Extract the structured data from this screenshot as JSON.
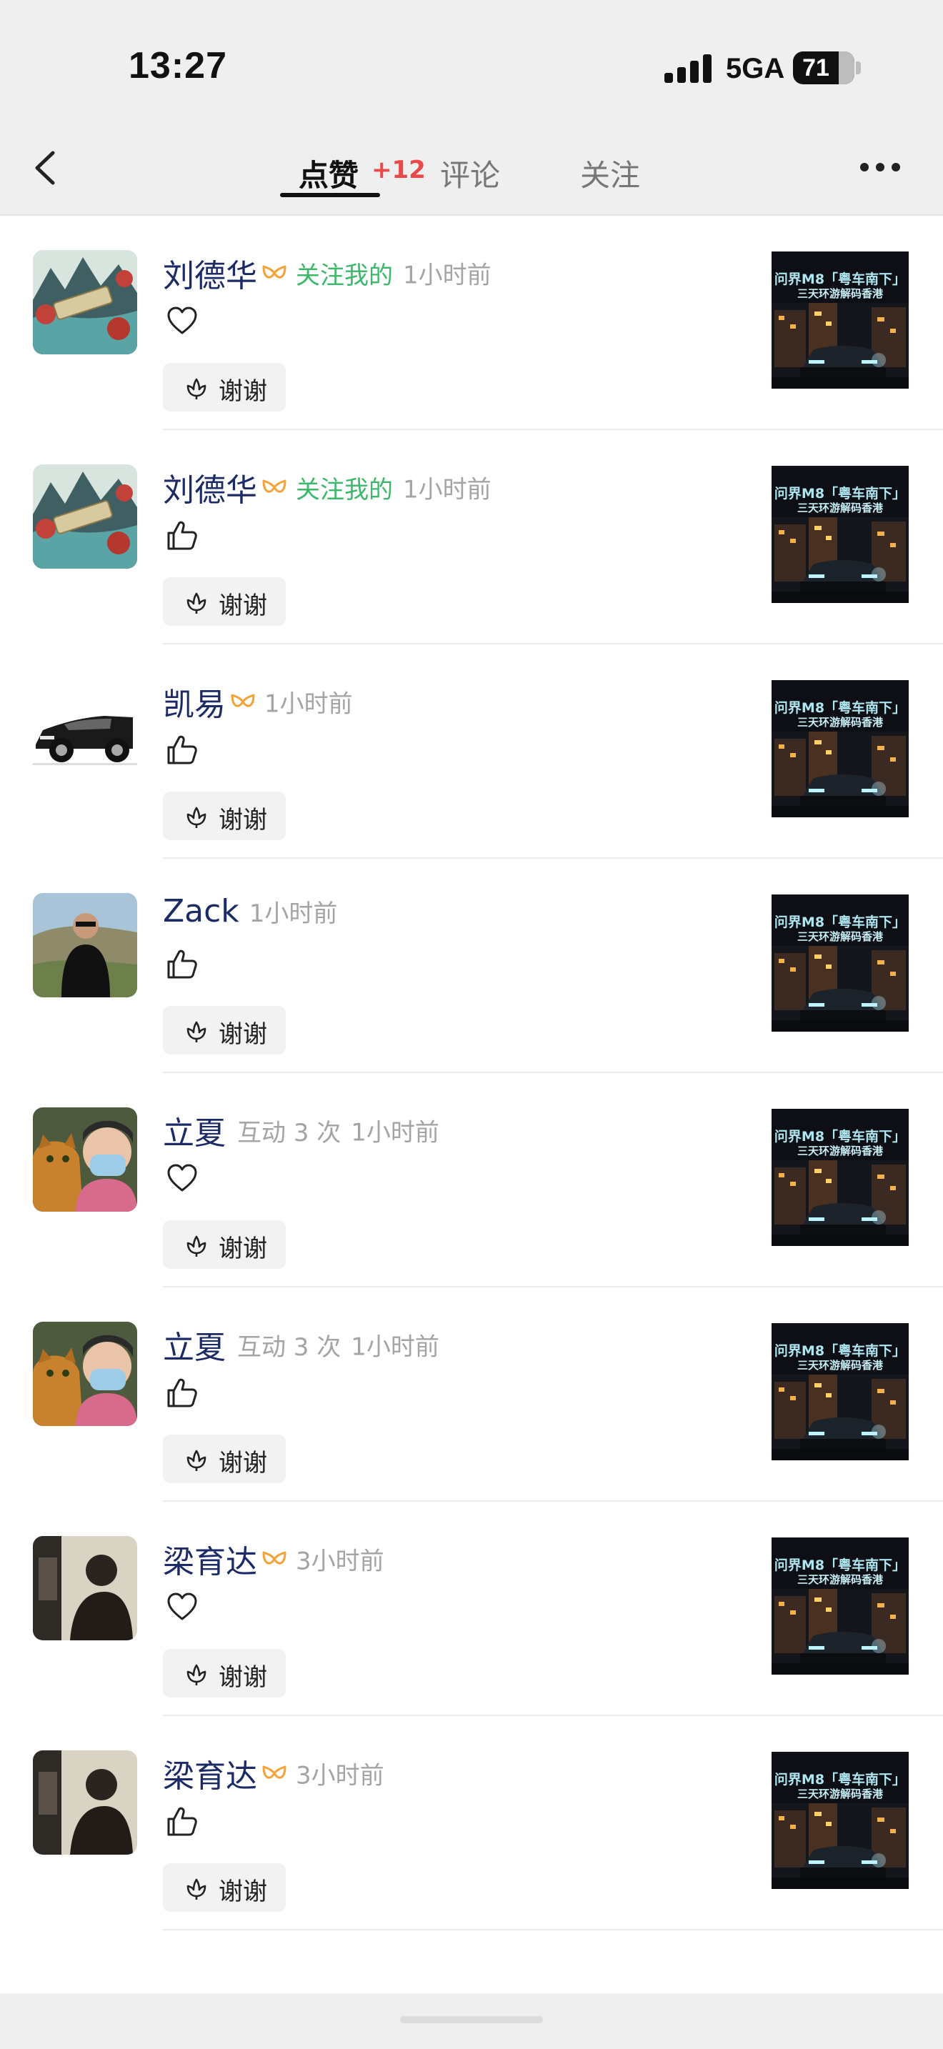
{
  "status_bar": {
    "time": "13:27",
    "network": "5GA",
    "battery": "71"
  },
  "header": {
    "tabs": [
      {
        "label": "点赞",
        "badge": "+12",
        "active": true
      },
      {
        "label": "评论",
        "active": false
      },
      {
        "label": "关注",
        "active": false
      }
    ],
    "back_icon": "chevron-left-icon",
    "more_icon": "more-dots-icon"
  },
  "notifications": [
    {
      "name": "刘德华",
      "vip": true,
      "follow_tag": "关注我的",
      "interaction": "",
      "time": "1小时前",
      "reaction": "heart",
      "button": "谢谢",
      "avatar": "landscape-painting",
      "post": {
        "line1": "问界M8「粤车南下」",
        "line2": "三天环游解码香港"
      }
    },
    {
      "name": "刘德华",
      "vip": true,
      "follow_tag": "关注我的",
      "interaction": "",
      "time": "1小时前",
      "reaction": "thumbs-up",
      "button": "谢谢",
      "avatar": "landscape-painting",
      "post": {
        "line1": "问界M8「粤车南下」",
        "line2": "三天环游解码香港"
      }
    },
    {
      "name": "凯易",
      "vip": true,
      "follow_tag": "",
      "interaction": "",
      "time": "1小时前",
      "reaction": "thumbs-up",
      "button": "谢谢",
      "avatar": "black-car",
      "post": {
        "line1": "问界M8「粤车南下」",
        "line2": "三天环游解码香港"
      }
    },
    {
      "name": "Zack",
      "vip": false,
      "follow_tag": "",
      "interaction": "",
      "time": "1小时前",
      "reaction": "thumbs-up",
      "button": "谢谢",
      "avatar": "person-outdoors",
      "post": {
        "line1": "问界M8「粤车南下」",
        "line2": "三天环游解码香港"
      }
    },
    {
      "name": "立夏",
      "vip": false,
      "follow_tag": "",
      "interaction": "互动 3 次",
      "time": "1小时前",
      "reaction": "heart",
      "button": "谢谢",
      "avatar": "cat-and-person-mask",
      "post": {
        "line1": "问界M8「粤车南下」",
        "line2": "三天环游解码香港"
      }
    },
    {
      "name": "立夏",
      "vip": false,
      "follow_tag": "",
      "interaction": "互动 3 次",
      "time": "1小时前",
      "reaction": "thumbs-up",
      "button": "谢谢",
      "avatar": "cat-and-person-mask",
      "post": {
        "line1": "问界M8「粤车南下」",
        "line2": "三天环游解码香港"
      }
    },
    {
      "name": "梁育达",
      "vip": true,
      "follow_tag": "",
      "interaction": "",
      "time": "3小时前",
      "reaction": "heart",
      "button": "谢谢",
      "avatar": "silhouette-room",
      "post": {
        "line1": "问界M8「粤车南下」",
        "line2": "三天环游解码香港"
      }
    },
    {
      "name": "梁育达",
      "vip": true,
      "follow_tag": "",
      "interaction": "",
      "time": "3小时前",
      "reaction": "thumbs-up",
      "button": "谢谢",
      "avatar": "silhouette-room",
      "post": {
        "line1": "问界M8「粤车南下」",
        "line2": "三天环游解码香港"
      }
    }
  ]
}
